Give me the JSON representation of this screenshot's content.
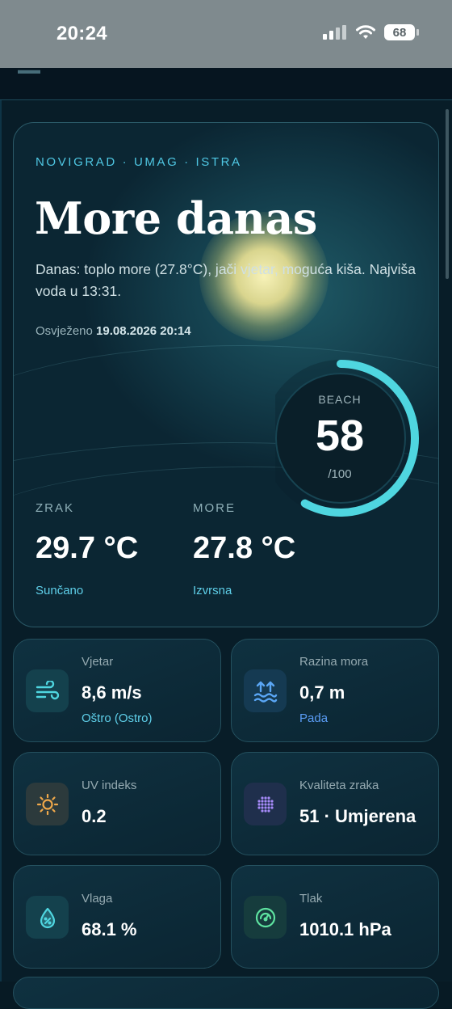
{
  "status_bar": {
    "time": "20:24",
    "battery": "68"
  },
  "hero": {
    "location": "NOVIGRAD · UMAG · ISTRA",
    "title": "More danas",
    "summary": "Danas: toplo more (27.8°C), jači vjetar, moguća kiša. Najviša voda u 13:31.",
    "updated_prefix": "Osvježeno",
    "updated_value": "19.08.2026 20:14",
    "score": {
      "label": "BEACH",
      "value": "58",
      "max": "/100",
      "fraction": 0.58
    },
    "air": {
      "label": "ZRAK",
      "value": "29.7 °C",
      "condition": "Sunčano"
    },
    "sea": {
      "label": "MORE",
      "value": "27.8 °C",
      "condition": "Izvrsna"
    }
  },
  "metrics": [
    {
      "label": "Vjetar",
      "value": "8,6 m/s",
      "sub": "Oštro (Ostro)",
      "icon": "wind-icon",
      "sub_color": "#5fd0ea"
    },
    {
      "label": "Razina mora",
      "value": "0,7 m",
      "sub": "Pada",
      "icon": "sea-level-icon",
      "sub_color": "#5a9cf5"
    },
    {
      "label": "UV indeks",
      "value": "0.2",
      "icon": "uv-sun-icon"
    },
    {
      "label": "Kvaliteta zraka",
      "value": "51 · Umjerena",
      "icon": "air-quality-icon"
    },
    {
      "label": "Vlaga",
      "value": "68.1 %",
      "icon": "humidity-drop-icon"
    },
    {
      "label": "Tlak",
      "value": "1010.1 hPa",
      "icon": "pressure-gauge-icon"
    }
  ],
  "colors": {
    "accent": "#4fd6e0",
    "wind": "#5fd0ea",
    "sea_level": "#5a9cf5",
    "uv": "#f0a84a",
    "air_quality": "#a78bfa",
    "humidity": "#4fd6e0",
    "pressure": "#5ee3a0"
  }
}
